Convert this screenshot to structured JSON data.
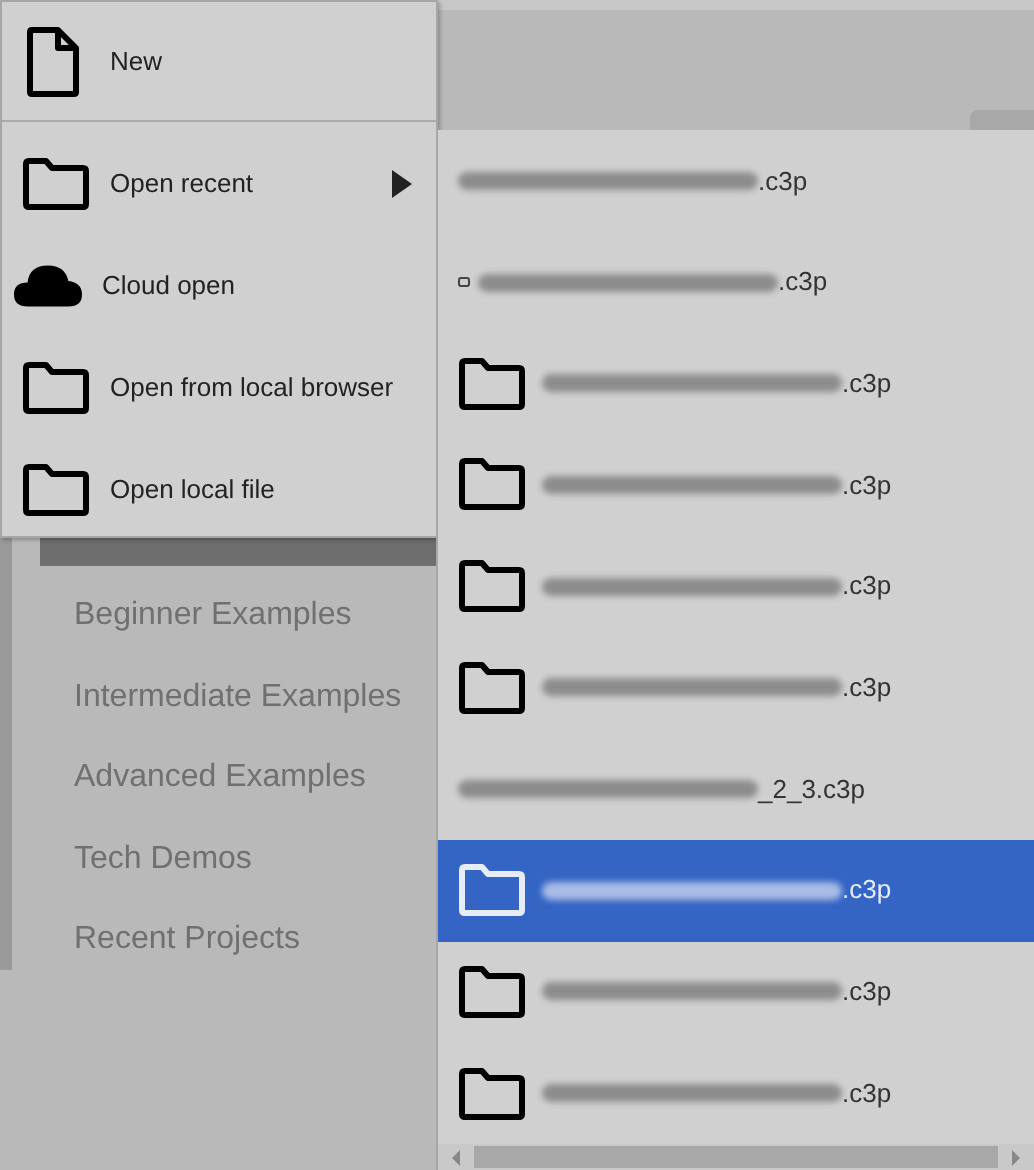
{
  "sidebar": {
    "items": [
      {
        "label": "Beginner Examples",
        "selected": false
      },
      {
        "label": "Intermediate Examples",
        "selected": false
      },
      {
        "label": "Advanced Examples",
        "selected": false
      },
      {
        "label": "Tech Demos",
        "selected": false
      },
      {
        "label": "Recent Projects",
        "selected": false
      }
    ]
  },
  "menu": {
    "items": [
      {
        "label": "New",
        "kind": "file",
        "submenu": false
      },
      {
        "label": "Open recent",
        "kind": "folder",
        "submenu": true
      },
      {
        "label": "Cloud open",
        "kind": "cloud",
        "submenu": false
      },
      {
        "label": "Open from local browser",
        "kind": "folder",
        "submenu": false
      },
      {
        "label": "Open local file",
        "kind": "folder",
        "submenu": false
      }
    ]
  },
  "recent": {
    "items": [
      {
        "label": ".c3p",
        "kind": "none",
        "selected": false
      },
      {
        "label": ".c3p",
        "kind": "small",
        "selected": false
      },
      {
        "label": ".c3p",
        "kind": "folder",
        "selected": false
      },
      {
        "label": ".c3p",
        "kind": "folder",
        "selected": false
      },
      {
        "label": ".c3p",
        "kind": "folder",
        "selected": false
      },
      {
        "label": ".c3p",
        "kind": "folder",
        "selected": false
      },
      {
        "label": "_2_3.c3p",
        "kind": "none",
        "selected": false
      },
      {
        "label": ".c3p",
        "kind": "folder",
        "selected": true
      },
      {
        "label": ".c3p",
        "kind": "folder",
        "selected": false
      },
      {
        "label": ".c3p",
        "kind": "folder",
        "selected": false
      }
    ]
  }
}
